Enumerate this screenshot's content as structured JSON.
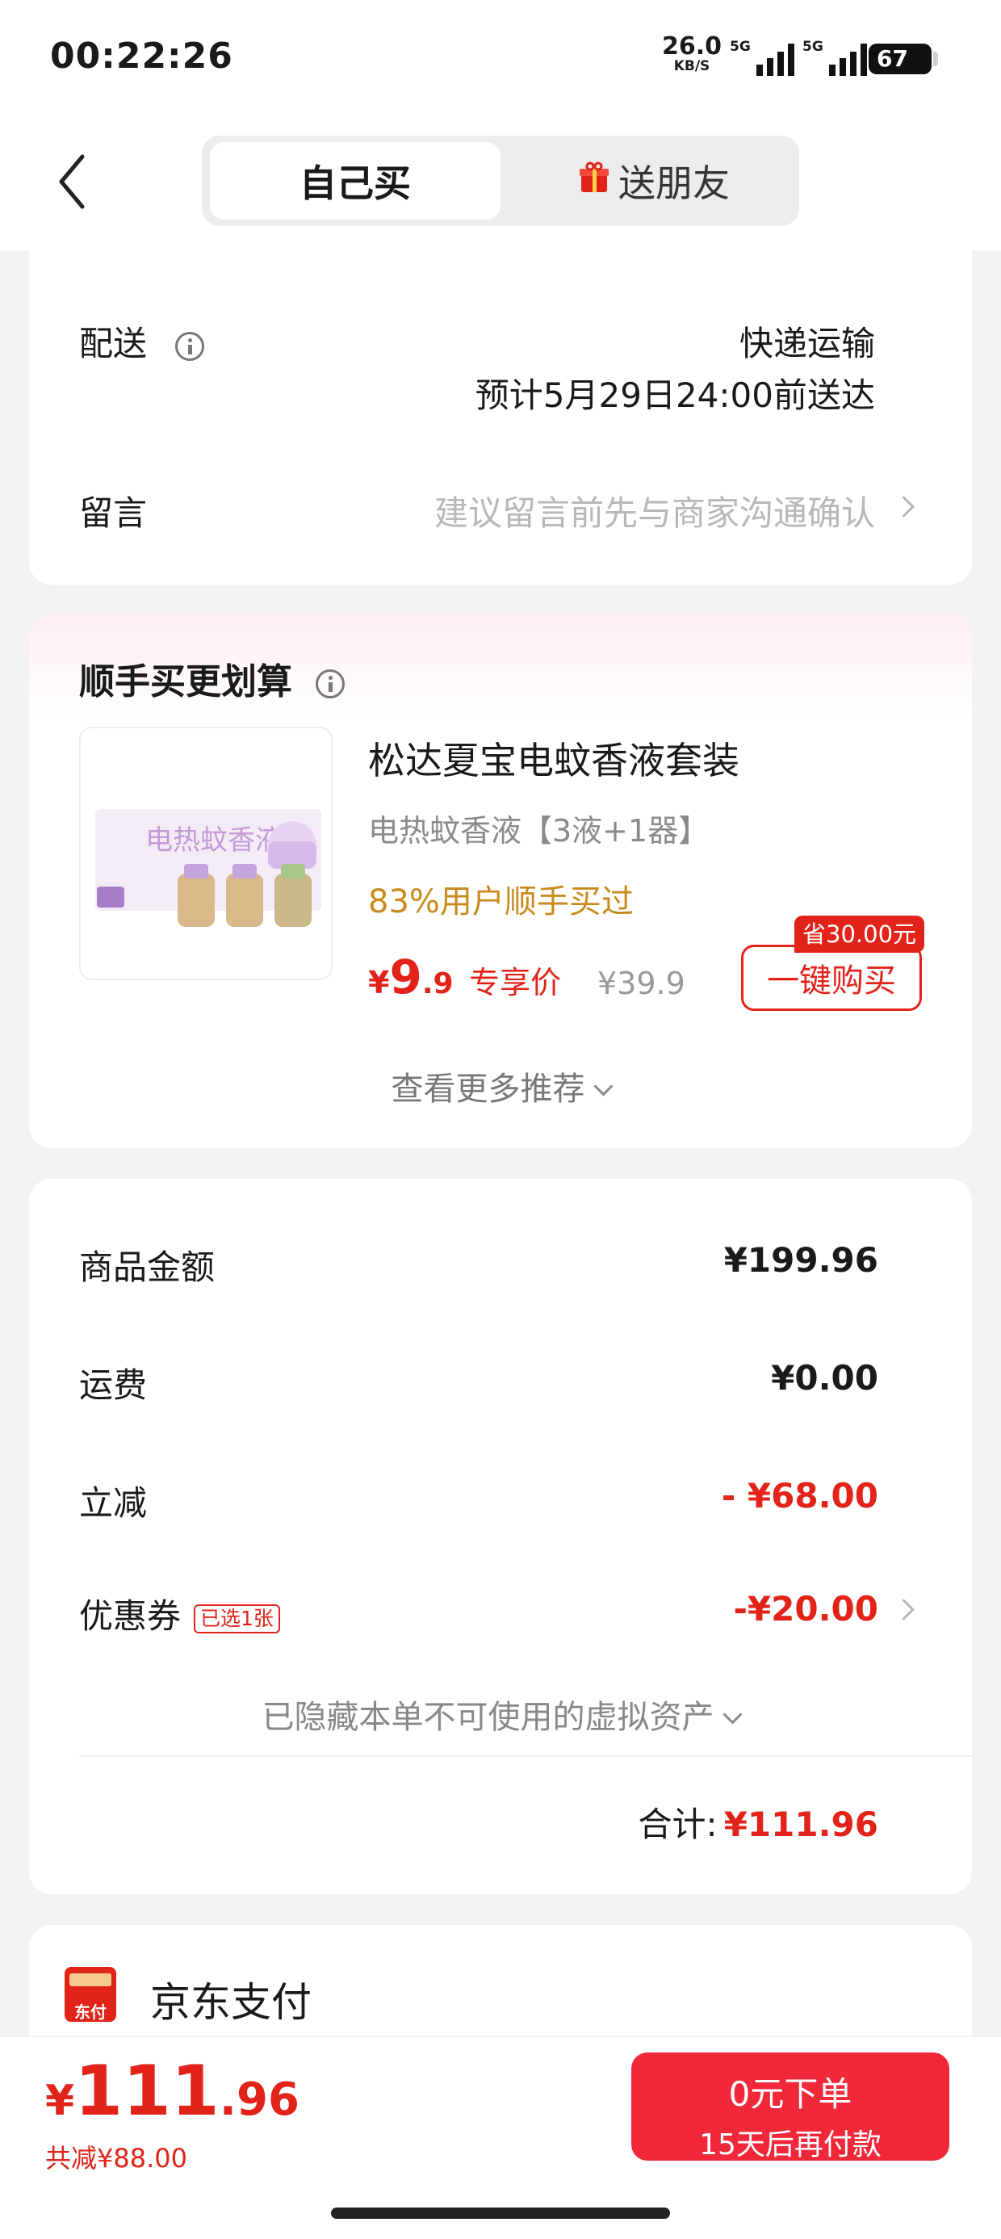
{
  "status_bar": {
    "time": "00:22:26",
    "net_speed": "26.0",
    "net_unit": "KB/S",
    "sim1": "5G",
    "sim2": "5G",
    "battery": "67"
  },
  "header": {
    "tab_self": "自己买",
    "tab_gift": "送朋友",
    "gift_icon": "gift-icon"
  },
  "delivery": {
    "label": "配送",
    "method": "快递运输",
    "eta": "预计5月29日24:00前送达",
    "message_label": "留言",
    "message_placeholder": "建议留言前先与商家沟通确认"
  },
  "addon": {
    "title": "顺手买更划算",
    "product_name": "松达夏宝电蚊香液套装",
    "product_spec": "电热蚊香液【3液+1器】",
    "social_proof": "83%用户顺手买过",
    "price_symbol": "¥",
    "price_int": "9",
    "price_dec": ".9",
    "price_label": "专享价",
    "original_price": "¥39.9",
    "buy_button": "一键购买",
    "save_badge": "省30.00元",
    "more_link": "查看更多推荐",
    "image_text": "电热蚊香液"
  },
  "summary": {
    "items": [
      {
        "label": "商品金额",
        "value": "¥199.96"
      },
      {
        "label": "运费",
        "value": "¥0.00"
      },
      {
        "label": "立减",
        "value": "- ¥68.00"
      },
      {
        "label": "优惠券",
        "value": "-¥20.00",
        "tag": "已选1张"
      }
    ],
    "hidden_assets": "已隐藏本单不可使用的虚拟资产",
    "total_label": "合计:",
    "total_value": "¥111.96"
  },
  "payment": {
    "method": "京东支付",
    "icon_text": "东付"
  },
  "bottom": {
    "price_symbol": "¥",
    "price_int": "111",
    "price_dec": ".96",
    "total_saved": "共减¥88.00",
    "checkout_main": "0元下单",
    "checkout_sub": "15天后再付款"
  },
  "colors": {
    "accent_red": "#e2231a",
    "checkout_red": "#f0283a",
    "orange": "#c98a1c"
  }
}
